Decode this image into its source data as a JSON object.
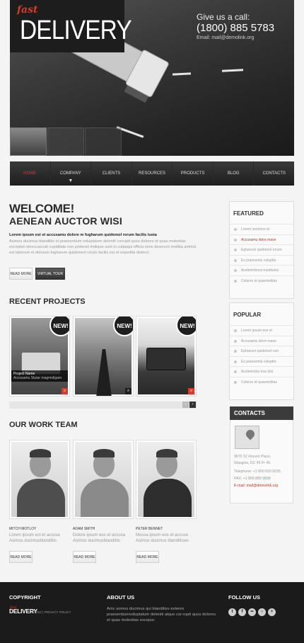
{
  "brand": {
    "fast": "fast",
    "name": "DELIVERY"
  },
  "call": {
    "label": "Give us a call:",
    "phone": "(1800) 885 5783",
    "email": "Email: mail@demolink.org"
  },
  "nav": [
    "Home",
    "Company",
    "Clients",
    "Resources",
    "Products",
    "Blog",
    "Contacts"
  ],
  "welcome": {
    "title": "WELCOME!",
    "subtitle": "AENEAN AUCTOR WISI",
    "lead": "Lorem ipsum est et accusamu dolore m fugharum quidemol rorum facilis iusta",
    "body": "Asimos ducimus blanditiis et praesentium voluptatum deleniti corrupti quos dolores et quas molestias excepturi sinoccaecati cupiditate non pridenet imilique sunt in culpaqui officia mois deserunt mollitia animid est laborum et dolorum fugharum quidemed rorum facilis est et expedita distinct.",
    "btn_more": "Read More",
    "btn_tour": "Virtual Tour"
  },
  "projects": {
    "title": "RECENT PROJECTS",
    "items": [
      {
        "badge": "NEW!",
        "name": "Project Name",
        "desc": "Accusamu Stutar magmidigam"
      },
      {
        "badge": "NEW!"
      },
      {
        "badge": "NEW!"
      }
    ],
    "prev": "‹",
    "next": "›"
  },
  "team": {
    "title": "OUR WORK TEAM",
    "members": [
      {
        "name": "MITCH MOTLOY",
        "desc": "Lorem ipsum est et accusa Asimos ducimusblanditiis"
      },
      {
        "name": "ADAM SMITH",
        "desc": "Dolore ipsum eos et accusa Asimos ducimusblanditiis"
      },
      {
        "name": "PETER BENNET",
        "desc": "Mossa ipsum eos et accuse Asimos ducimus blanditiises"
      }
    ],
    "btn": "Read More"
  },
  "featured": {
    "title": "FEATURED",
    "items": [
      "Lorem ioumeos et",
      "Accusamu dolre mase",
      "Eghanum quidemol rorum",
      "Es praesentiu voluptte",
      "Acelerinttensi traotitutos",
      "Colores et quasmolitas"
    ]
  },
  "popular": {
    "title": "POPULAR",
    "items": [
      "Lorem ipsum eos et",
      "Accusamu dorm mase",
      "Ephanum quidemol rum",
      "Es praesentiu voluptte",
      "Acelerintiou trus dos",
      "Colores et quasmolitas"
    ]
  },
  "contacts": {
    "title": "CONTACTS",
    "address1": "9870 St Vincent Place,",
    "address2": "Glasgow, DC 45 Fr 45.",
    "telephone": "Telephone:   +1 800 603 6035",
    "fax": "FAX:           +1 800 889 9898",
    "email": "E-mail: mail@demolink.org"
  },
  "footer": {
    "copyright_title": "COPYRIGHT",
    "logo_fast": "fast",
    "logo": "DELIVERY",
    "copy": "© 2012 | PRIVACY POLICY",
    "about_title": "ABOUT US",
    "about_text": "Amc somos ducimus qui blanditiss esteres praesentiumvoluptatum deleniti atque cor-rupti quos dolores et quas molestias excepur.",
    "follow_title": "FOLLOW US",
    "social": [
      "t",
      "f",
      "••",
      "○",
      "+"
    ]
  }
}
